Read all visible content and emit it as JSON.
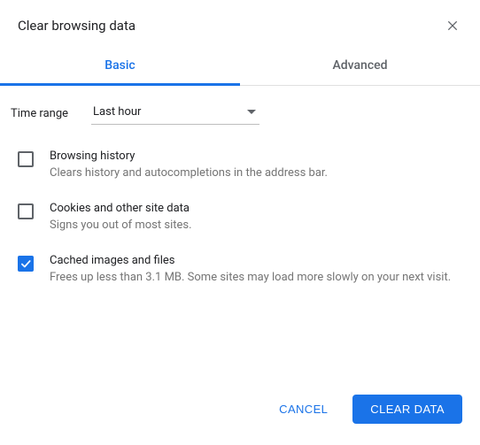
{
  "dialog": {
    "title": "Clear browsing data"
  },
  "tabs": {
    "basic": "Basic",
    "advanced": "Advanced",
    "active": "basic"
  },
  "timerange": {
    "label": "Time range",
    "value": "Last hour"
  },
  "options": [
    {
      "title": "Browsing history",
      "desc": "Clears history and autocompletions in the address bar.",
      "checked": false
    },
    {
      "title": "Cookies and other site data",
      "desc": "Signs you out of most sites.",
      "checked": false
    },
    {
      "title": "Cached images and files",
      "desc": "Frees up less than 3.1 MB. Some sites may load more slowly on your next visit.",
      "checked": true
    }
  ],
  "footer": {
    "cancel": "CANCEL",
    "confirm": "CLEAR DATA"
  }
}
